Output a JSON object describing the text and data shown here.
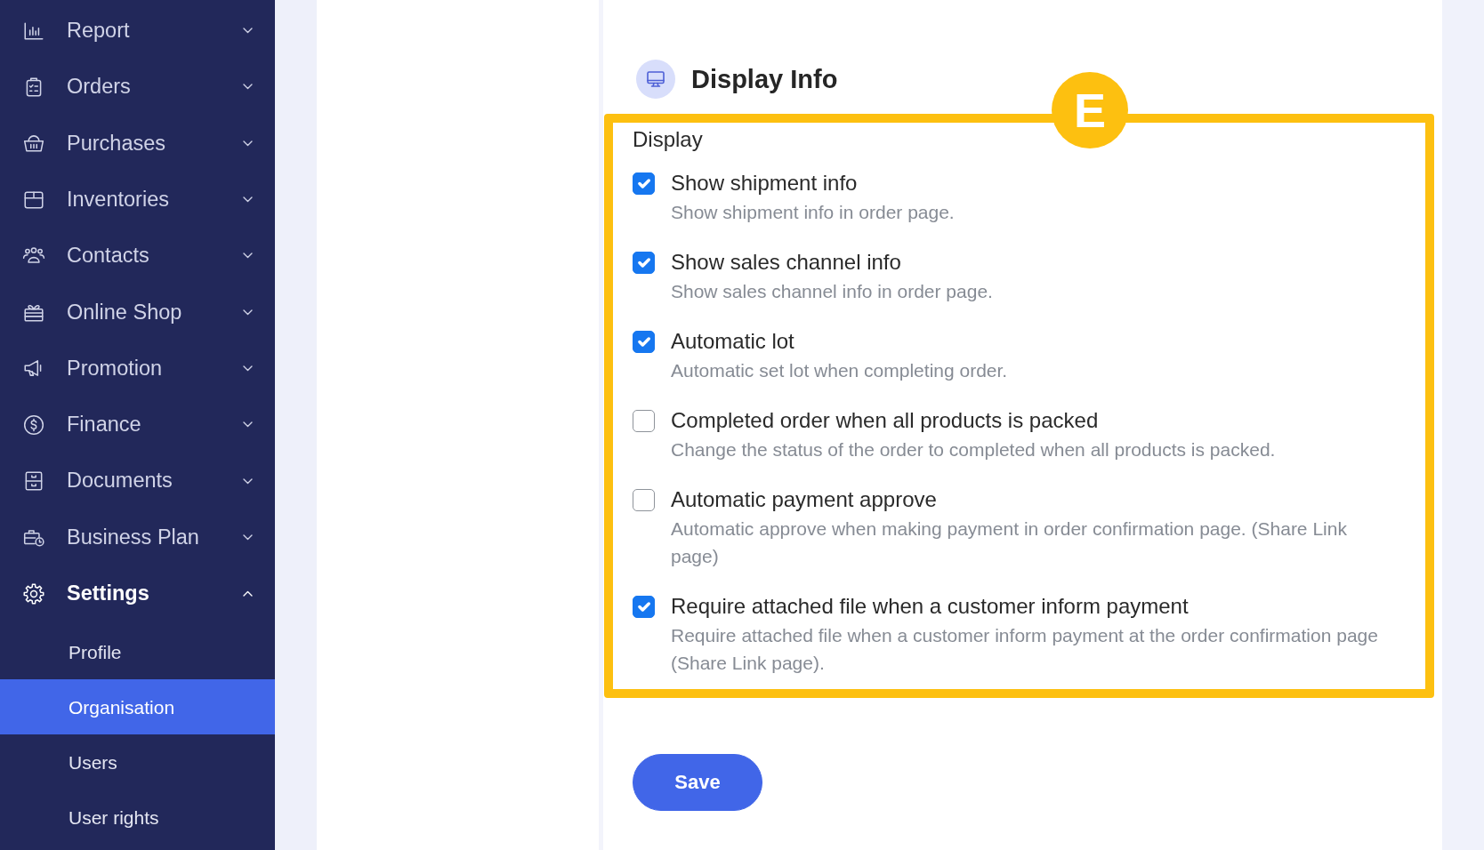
{
  "sidebar": {
    "items": [
      {
        "label": "Report",
        "expanded": false
      },
      {
        "label": "Orders",
        "expanded": false
      },
      {
        "label": "Purchases",
        "expanded": false
      },
      {
        "label": "Inventories",
        "expanded": false
      },
      {
        "label": "Contacts",
        "expanded": false
      },
      {
        "label": "Online Shop",
        "expanded": false
      },
      {
        "label": "Promotion",
        "expanded": false
      },
      {
        "label": "Finance",
        "expanded": false
      },
      {
        "label": "Documents",
        "expanded": false
      },
      {
        "label": "Business Plan",
        "expanded": false
      },
      {
        "label": "Settings",
        "expanded": true,
        "children": [
          {
            "label": "Profile",
            "selected": false
          },
          {
            "label": "Organisation",
            "selected": true
          },
          {
            "label": "Users",
            "selected": false
          },
          {
            "label": "User rights",
            "selected": false
          }
        ]
      }
    ]
  },
  "section": {
    "title": "Display Info",
    "callout": "E",
    "group_label": "Display",
    "options": [
      {
        "label": "Show shipment info",
        "description": "Show shipment info in order page.",
        "checked": true
      },
      {
        "label": "Show sales channel info",
        "description": "Show sales channel info in order page.",
        "checked": true
      },
      {
        "label": "Automatic lot",
        "description": "Automatic set lot when completing order.",
        "checked": true
      },
      {
        "label": "Completed order when all products is packed",
        "description": "Change the status of the order to completed when all products is packed.",
        "checked": false
      },
      {
        "label": "Automatic payment approve",
        "description": "Automatic approve when making payment in order confirmation page. (Share Link page)",
        "checked": false
      },
      {
        "label": "Require attached file when a customer inform payment",
        "description": "Require attached file when a customer inform payment at the order confirmation page (Share Link page).",
        "checked": true
      }
    ]
  },
  "save_button": {
    "label": "Save"
  }
}
